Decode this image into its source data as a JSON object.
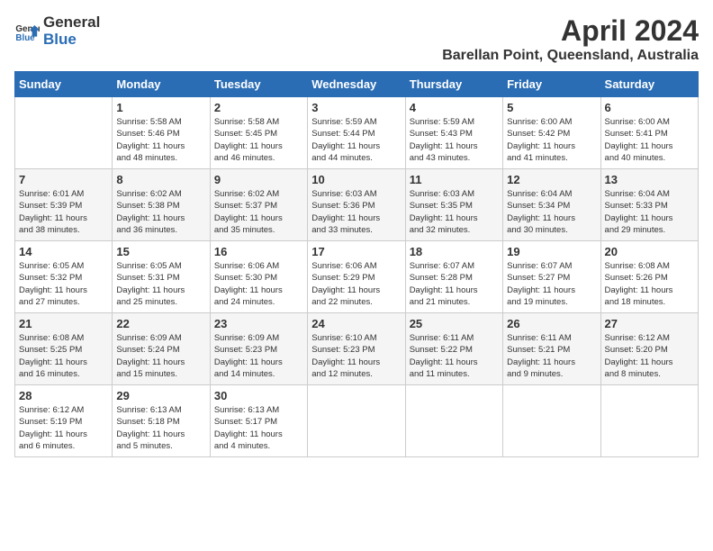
{
  "header": {
    "logo_general": "General",
    "logo_blue": "Blue",
    "month_title": "April 2024",
    "location": "Barellan Point, Queensland, Australia"
  },
  "days_of_week": [
    "Sunday",
    "Monday",
    "Tuesday",
    "Wednesday",
    "Thursday",
    "Friday",
    "Saturday"
  ],
  "weeks": [
    [
      {
        "day": "",
        "info": ""
      },
      {
        "day": "1",
        "info": "Sunrise: 5:58 AM\nSunset: 5:46 PM\nDaylight: 11 hours\nand 48 minutes."
      },
      {
        "day": "2",
        "info": "Sunrise: 5:58 AM\nSunset: 5:45 PM\nDaylight: 11 hours\nand 46 minutes."
      },
      {
        "day": "3",
        "info": "Sunrise: 5:59 AM\nSunset: 5:44 PM\nDaylight: 11 hours\nand 44 minutes."
      },
      {
        "day": "4",
        "info": "Sunrise: 5:59 AM\nSunset: 5:43 PM\nDaylight: 11 hours\nand 43 minutes."
      },
      {
        "day": "5",
        "info": "Sunrise: 6:00 AM\nSunset: 5:42 PM\nDaylight: 11 hours\nand 41 minutes."
      },
      {
        "day": "6",
        "info": "Sunrise: 6:00 AM\nSunset: 5:41 PM\nDaylight: 11 hours\nand 40 minutes."
      }
    ],
    [
      {
        "day": "7",
        "info": "Sunrise: 6:01 AM\nSunset: 5:39 PM\nDaylight: 11 hours\nand 38 minutes."
      },
      {
        "day": "8",
        "info": "Sunrise: 6:02 AM\nSunset: 5:38 PM\nDaylight: 11 hours\nand 36 minutes."
      },
      {
        "day": "9",
        "info": "Sunrise: 6:02 AM\nSunset: 5:37 PM\nDaylight: 11 hours\nand 35 minutes."
      },
      {
        "day": "10",
        "info": "Sunrise: 6:03 AM\nSunset: 5:36 PM\nDaylight: 11 hours\nand 33 minutes."
      },
      {
        "day": "11",
        "info": "Sunrise: 6:03 AM\nSunset: 5:35 PM\nDaylight: 11 hours\nand 32 minutes."
      },
      {
        "day": "12",
        "info": "Sunrise: 6:04 AM\nSunset: 5:34 PM\nDaylight: 11 hours\nand 30 minutes."
      },
      {
        "day": "13",
        "info": "Sunrise: 6:04 AM\nSunset: 5:33 PM\nDaylight: 11 hours\nand 29 minutes."
      }
    ],
    [
      {
        "day": "14",
        "info": "Sunrise: 6:05 AM\nSunset: 5:32 PM\nDaylight: 11 hours\nand 27 minutes."
      },
      {
        "day": "15",
        "info": "Sunrise: 6:05 AM\nSunset: 5:31 PM\nDaylight: 11 hours\nand 25 minutes."
      },
      {
        "day": "16",
        "info": "Sunrise: 6:06 AM\nSunset: 5:30 PM\nDaylight: 11 hours\nand 24 minutes."
      },
      {
        "day": "17",
        "info": "Sunrise: 6:06 AM\nSunset: 5:29 PM\nDaylight: 11 hours\nand 22 minutes."
      },
      {
        "day": "18",
        "info": "Sunrise: 6:07 AM\nSunset: 5:28 PM\nDaylight: 11 hours\nand 21 minutes."
      },
      {
        "day": "19",
        "info": "Sunrise: 6:07 AM\nSunset: 5:27 PM\nDaylight: 11 hours\nand 19 minutes."
      },
      {
        "day": "20",
        "info": "Sunrise: 6:08 AM\nSunset: 5:26 PM\nDaylight: 11 hours\nand 18 minutes."
      }
    ],
    [
      {
        "day": "21",
        "info": "Sunrise: 6:08 AM\nSunset: 5:25 PM\nDaylight: 11 hours\nand 16 minutes."
      },
      {
        "day": "22",
        "info": "Sunrise: 6:09 AM\nSunset: 5:24 PM\nDaylight: 11 hours\nand 15 minutes."
      },
      {
        "day": "23",
        "info": "Sunrise: 6:09 AM\nSunset: 5:23 PM\nDaylight: 11 hours\nand 14 minutes."
      },
      {
        "day": "24",
        "info": "Sunrise: 6:10 AM\nSunset: 5:23 PM\nDaylight: 11 hours\nand 12 minutes."
      },
      {
        "day": "25",
        "info": "Sunrise: 6:11 AM\nSunset: 5:22 PM\nDaylight: 11 hours\nand 11 minutes."
      },
      {
        "day": "26",
        "info": "Sunrise: 6:11 AM\nSunset: 5:21 PM\nDaylight: 11 hours\nand 9 minutes."
      },
      {
        "day": "27",
        "info": "Sunrise: 6:12 AM\nSunset: 5:20 PM\nDaylight: 11 hours\nand 8 minutes."
      }
    ],
    [
      {
        "day": "28",
        "info": "Sunrise: 6:12 AM\nSunset: 5:19 PM\nDaylight: 11 hours\nand 6 minutes."
      },
      {
        "day": "29",
        "info": "Sunrise: 6:13 AM\nSunset: 5:18 PM\nDaylight: 11 hours\nand 5 minutes."
      },
      {
        "day": "30",
        "info": "Sunrise: 6:13 AM\nSunset: 5:17 PM\nDaylight: 11 hours\nand 4 minutes."
      },
      {
        "day": "",
        "info": ""
      },
      {
        "day": "",
        "info": ""
      },
      {
        "day": "",
        "info": ""
      },
      {
        "day": "",
        "info": ""
      }
    ]
  ]
}
